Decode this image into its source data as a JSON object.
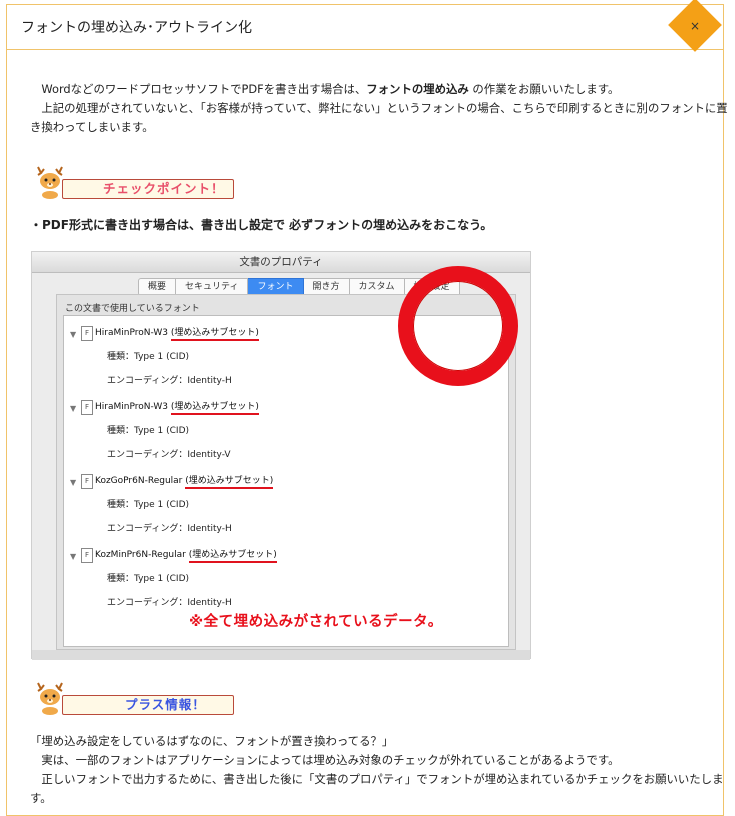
{
  "header": {
    "title": "フォントの埋め込み･アウトライン化",
    "close_label": "×"
  },
  "intro": {
    "line1_pre": "　Wordなどのワードプロセッサソフトで",
    "line1_pdf": "PDF",
    "line1_mid": "を書き出す場合は、",
    "line1_bold": "フォントの埋め込み",
    "line1_post": " の作業をお願いいたします。",
    "line2": "　上記の処理がされていないと、「お客様が持っていて、弊社にない」というフォントの場合、こちらで印刷するときに別のフォントに置",
    "line3": "き換わってしまいます。"
  },
  "checkpoint": {
    "label": "チェックポイント！",
    "color": "#e8506a"
  },
  "subhead": "・PDF形式に書き出す場合は、書き出し設定で 必ずフォントの埋め込みをおこなう。",
  "dialog": {
    "title": "文書のプロパティ",
    "tabs": [
      "概要",
      "セキュリティ",
      "フォント",
      "開き方",
      "カスタム",
      "詳細設定"
    ],
    "active_tab": "フォント",
    "panel_label": "この文書で使用しているフォント",
    "fonts": [
      {
        "name": "HiraMinProN-W3",
        "tag": "(埋め込みサブセット)",
        "type": "種類：Type 1 (CID)",
        "encoding": "エンコーディング：Identity-H"
      },
      {
        "name": "HiraMinProN-W3",
        "tag": "(埋め込みサブセット)",
        "type": "種類：Type 1 (CID)",
        "encoding": "エンコーディング：Identity-V"
      },
      {
        "name": "KozGoPr6N-Regular",
        "tag": "(埋め込みサブセット)",
        "type": "種類：Type 1 (CID)",
        "encoding": "エンコーディング：Identity-H"
      },
      {
        "name": "KozMinPr6N-Regular",
        "tag": "(埋め込みサブセット)",
        "type": "種類：Type 1 (CID)",
        "encoding": "エンコーディング：Identity-H"
      }
    ],
    "caption": "※全て埋め込みがされているデータ。",
    "highlight_color": "#e8101b"
  },
  "plus": {
    "label": "プラス情報！",
    "color": "#3a55e0"
  },
  "outro": {
    "line1": "「埋め込み設定をしているはずなのに、フォントが置き換わってる？」",
    "line2": "　実は、一部のフォントはアプリケーションによっては埋め込み対象のチェックが外れていることがあるようです。",
    "line3": "　正しいフォントで出力するために、書き出した後に「文書のプロパティ」でフォントが埋め込まれているかチェックをお願いいたしま",
    "line4": "す。"
  }
}
